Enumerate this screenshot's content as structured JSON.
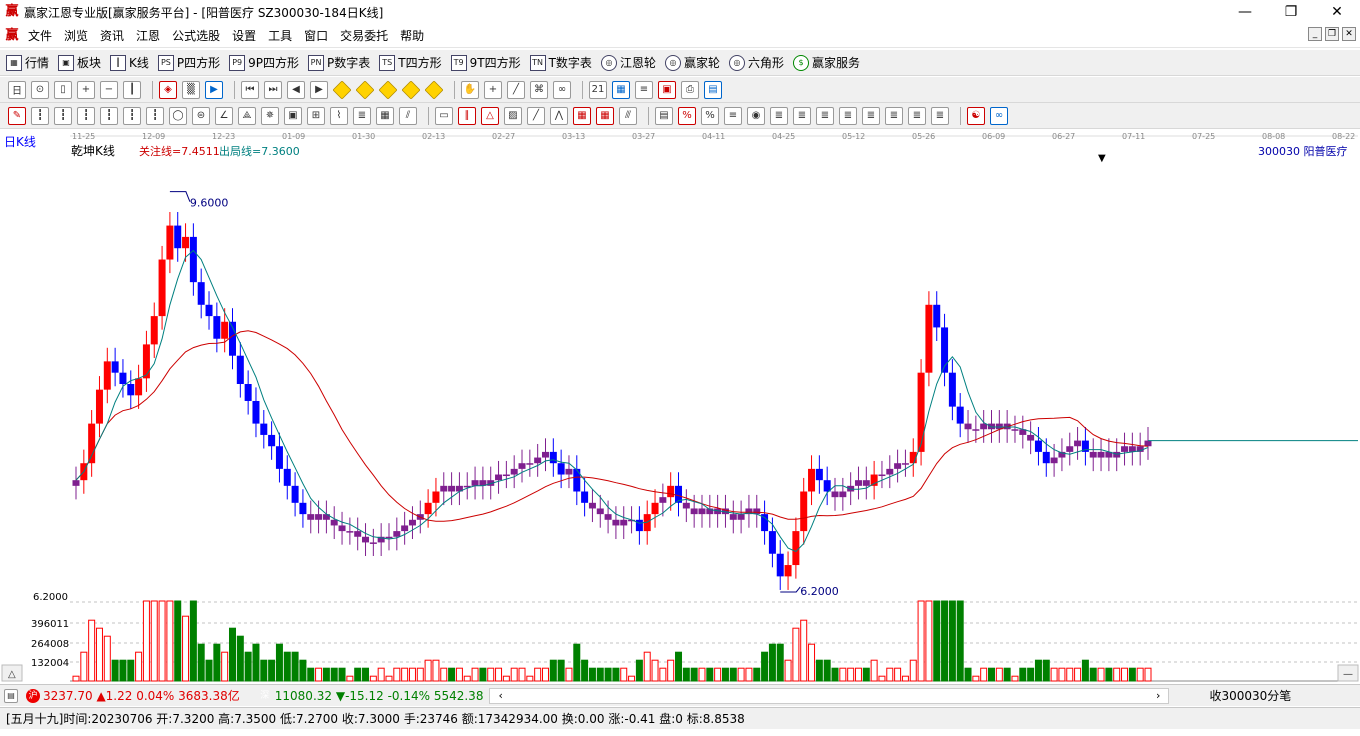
{
  "window": {
    "title": "赢家江恩专业版[赢家服务平台] - [阳普医疗   SZ300030-184日K线]",
    "minimize": "—",
    "maximize": "❐",
    "close": "✕"
  },
  "menu": [
    "文件",
    "浏览",
    "资讯",
    "江恩",
    "公式选股",
    "设置",
    "工具",
    "窗口",
    "交易委托",
    "帮助"
  ],
  "toolbar1": [
    {
      "label": "行情",
      "icon": "grid-icon",
      "glyph": "▦"
    },
    {
      "label": "板块",
      "icon": "blocks-icon",
      "glyph": "▣"
    },
    {
      "label": "K线",
      "icon": "candle-icon",
      "glyph": "┃"
    },
    {
      "label": "P四方形",
      "icon": "ps-icon",
      "glyph": "PS"
    },
    {
      "label": "9P四方形",
      "icon": "p9-icon",
      "glyph": "P9"
    },
    {
      "label": "P数字表",
      "icon": "pn-icon",
      "glyph": "PN"
    },
    {
      "label": "T四方形",
      "icon": "ts-icon",
      "glyph": "TS"
    },
    {
      "label": "9T四方形",
      "icon": "t9-icon",
      "glyph": "T9"
    },
    {
      "label": "T数字表",
      "icon": "tn-icon",
      "glyph": "TN"
    },
    {
      "label": "江恩轮",
      "icon": "gann-wheel-icon",
      "glyph": "◎"
    },
    {
      "label": "赢家轮",
      "icon": "winner-wheel-icon",
      "glyph": "◎"
    },
    {
      "label": "六角形",
      "icon": "hexagon-icon",
      "glyph": "◎"
    },
    {
      "label": "赢家服务",
      "icon": "dollar-icon",
      "glyph": "$"
    }
  ],
  "chart": {
    "period_label": "日K线",
    "indicator_name": "乾坤K线",
    "focus_line_label": "关注线=7.4511",
    "exit_line_label": "出局线=7.3600",
    "stock_label": "300030  阳普医疗",
    "high_marker": "9.6000",
    "low_marker": "6.2000",
    "dates": [
      "11-25",
      "12-09",
      "12-23",
      "01-09",
      "01-30",
      "02-13",
      "02-27",
      "03-13",
      "03-27",
      "04-11",
      "04-25",
      "05-12",
      "05-26",
      "06-09",
      "06-27",
      "07-11",
      "07-25",
      "08-08",
      "08-22"
    ],
    "vol_axis": [
      "6.2000",
      "396011",
      "264008",
      "132004"
    ],
    "colors": {
      "up": "#ff0000",
      "down": "#0000ff",
      "neutral": "#7f1f8f",
      "volume_up": "#ff0000",
      "volume_down": "#008000",
      "ma_short": "#008080",
      "ma_long": "#cc0000"
    }
  },
  "chart_data": {
    "type": "candlestick",
    "title": "阳普医疗 SZ300030 日K线",
    "ylim": [
      6.0,
      9.8
    ],
    "closes": [
      7.05,
      7.2,
      7.55,
      7.85,
      8.1,
      8.0,
      7.9,
      7.8,
      7.95,
      8.25,
      8.5,
      9.0,
      9.3,
      9.1,
      9.2,
      8.8,
      8.6,
      8.5,
      8.3,
      8.45,
      8.15,
      7.9,
      7.75,
      7.55,
      7.45,
      7.35,
      7.15,
      7.0,
      6.85,
      6.75,
      6.7,
      6.75,
      6.7,
      6.65,
      6.6,
      6.6,
      6.55,
      6.5,
      6.5,
      6.55,
      6.55,
      6.6,
      6.65,
      6.7,
      6.75,
      6.85,
      6.95,
      7.0,
      6.95,
      7.0,
      7.0,
      7.05,
      7.0,
      7.05,
      7.1,
      7.1,
      7.15,
      7.2,
      7.2,
      7.25,
      7.3,
      7.2,
      7.1,
      7.15,
      6.95,
      6.85,
      6.8,
      6.75,
      6.7,
      6.65,
      6.7,
      6.7,
      6.6,
      6.75,
      6.85,
      6.9,
      7.0,
      6.85,
      6.8,
      6.75,
      6.8,
      6.75,
      6.8,
      6.75,
      6.7,
      6.75,
      6.8,
      6.75,
      6.6,
      6.4,
      6.2,
      6.3,
      6.6,
      6.95,
      7.15,
      7.05,
      6.95,
      6.9,
      6.95,
      7.0,
      7.05,
      7.0,
      7.1,
      7.1,
      7.15,
      7.2,
      7.2,
      7.3,
      8.0,
      8.6,
      8.4,
      8.0,
      7.7,
      7.55,
      7.5,
      7.5,
      7.55,
      7.5,
      7.55,
      7.5,
      7.5,
      7.45,
      7.4,
      7.3,
      7.2,
      7.25,
      7.3,
      7.35,
      7.4,
      7.3,
      7.25,
      7.3,
      7.25,
      7.3,
      7.35,
      7.3,
      7.35,
      7.4
    ],
    "volume_peak": 528000
  }
}
